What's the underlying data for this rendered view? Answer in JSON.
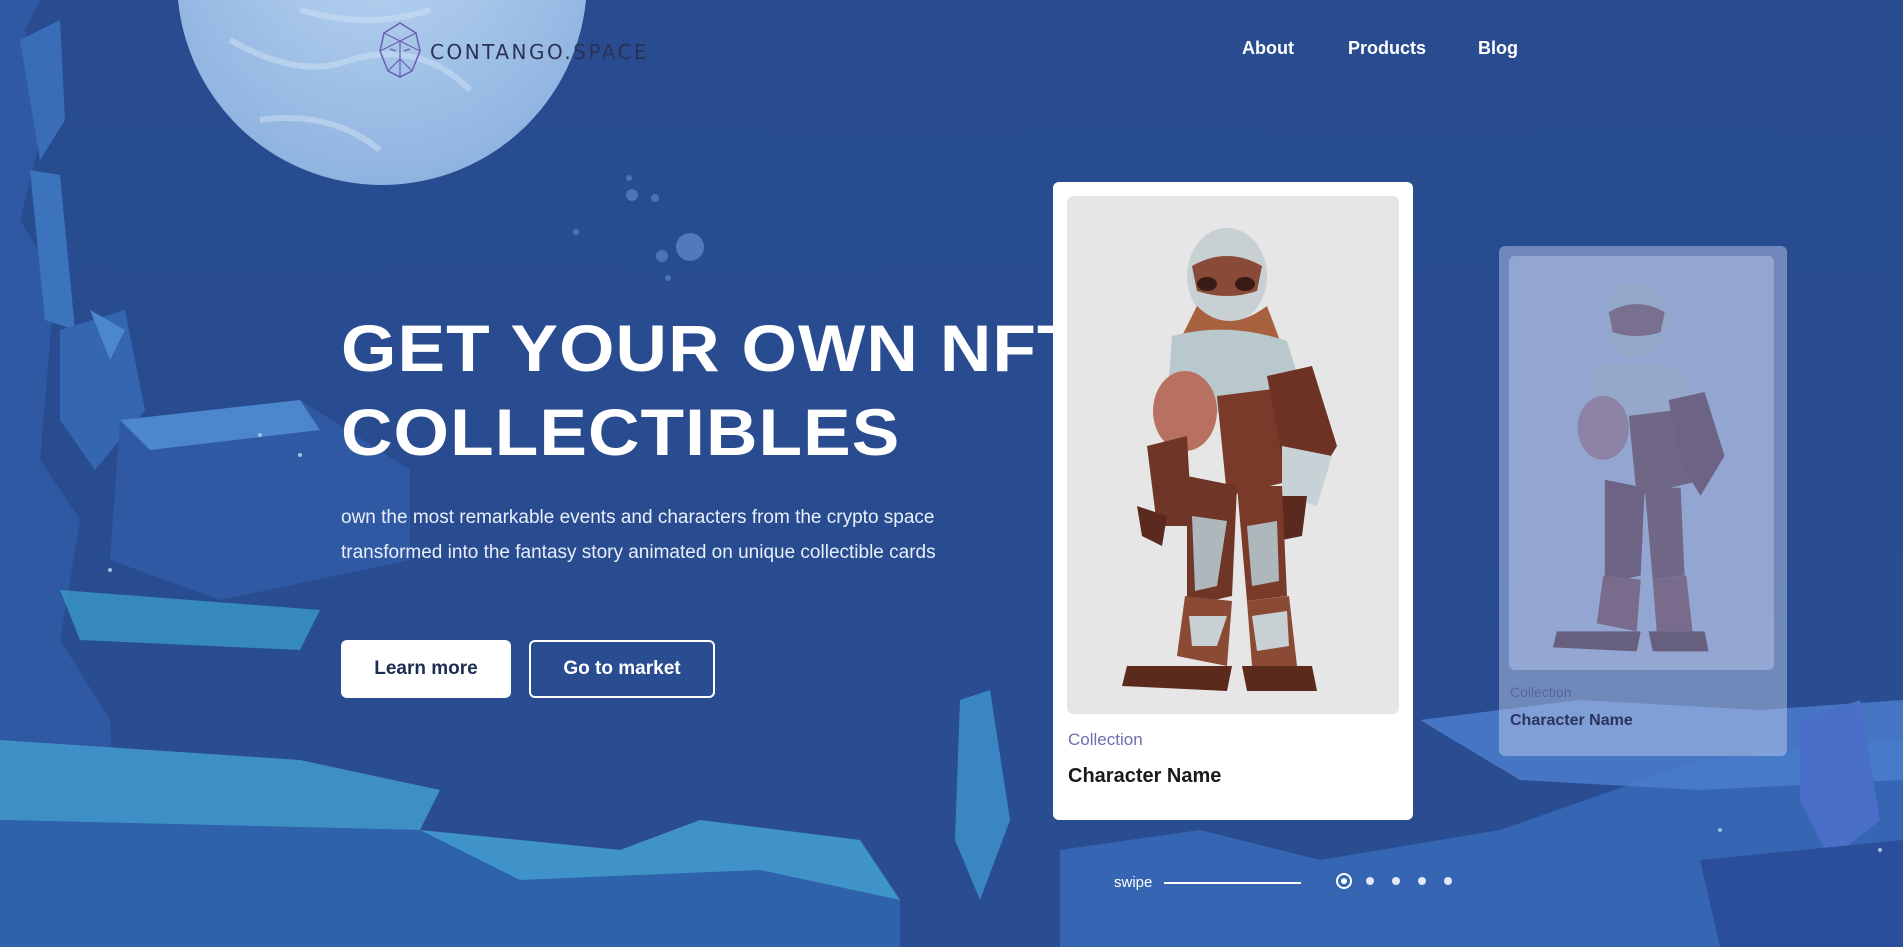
{
  "brand": {
    "logo_text": "CONTANGO.SPACE",
    "logo_icon": "geometric-face-logo"
  },
  "nav": {
    "items": [
      {
        "label": "About"
      },
      {
        "label": "Products"
      },
      {
        "label": "Blog"
      }
    ]
  },
  "hero": {
    "title_line1": "GET YOUR OWN NFT",
    "title_line2": "COLLECTIBLES",
    "subtitle_line1": "own the most remarkable events and characters from the crypto space",
    "subtitle_line2": "transformed into the fantasy story animated on unique collectible cards",
    "primary_button": "Learn more",
    "secondary_button": "Go to market"
  },
  "cards": [
    {
      "collection": "Collection",
      "name": "Character Name",
      "image": "armored-robot-character"
    },
    {
      "collection": "Collection",
      "name": "Character Name",
      "image": "armored-robot-character"
    }
  ],
  "carousel": {
    "swipe_label": "swipe",
    "dot_count": 5,
    "active_index": 0
  },
  "colors": {
    "background": "#274b8e",
    "moon": "#a9c8ea",
    "accent_text": "#6b6fb0",
    "button_text": "#1d2d52"
  }
}
